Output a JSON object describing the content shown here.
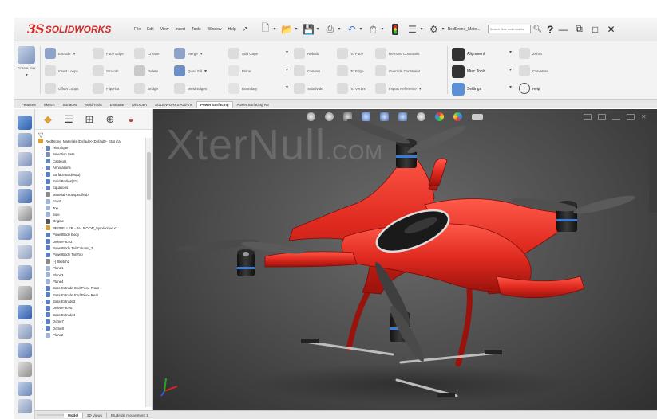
{
  "app": {
    "brand_prefix": "3S",
    "brand_name": "SOLIDWORKS",
    "menus": [
      "File",
      "Edit",
      "View",
      "Insert",
      "Tools",
      "Window",
      "Help"
    ],
    "document_name": "RedDrone_Mate...",
    "search_placeholder": "Search files and models",
    "help_symbol": "?"
  },
  "ribbon": {
    "groups": [
      {
        "label": "Create Box"
      },
      {
        "label": "Extrude"
      },
      {
        "label": "Insert Loops"
      },
      {
        "label": "Offset Loops"
      },
      {
        "label": "Face Edge"
      },
      {
        "label": "Smooth"
      },
      {
        "label": "Flip/Flat"
      },
      {
        "label": "Crease"
      },
      {
        "label": "Delete"
      },
      {
        "label": "Bridge"
      },
      {
        "label": "Merge"
      },
      {
        "label": "Quad Fill"
      },
      {
        "label": "Weld Edges"
      },
      {
        "label": "Add Cage"
      },
      {
        "label": "Mirror"
      },
      {
        "label": "Boundary"
      },
      {
        "label": "Rebuild"
      },
      {
        "label": "Convert"
      },
      {
        "label": "Subdivide"
      },
      {
        "label": "To Face"
      },
      {
        "label": "To Edge"
      },
      {
        "label": "To Vertex"
      },
      {
        "label": "Remove Constraint"
      },
      {
        "label": "Override Constraint"
      },
      {
        "label": "Import Reference"
      },
      {
        "label": "Alignment"
      },
      {
        "label": "Misc Tools"
      },
      {
        "label": "Settings"
      },
      {
        "label": "Zebra"
      },
      {
        "label": "Curvature"
      },
      {
        "label": "Help"
      }
    ]
  },
  "tabs": [
    "Features",
    "Sketch",
    "Surfaces",
    "Mold Tools",
    "Evaluate",
    "DimXpert",
    "SOLIDWORKS Add-Ins",
    "Power Surfacing",
    "Power Surfacing RE"
  ],
  "active_tab": "Power Surfacing",
  "tree": {
    "root": "RedDrone_Materials (Default<<Default>_Etat d'a",
    "items": [
      {
        "label": "Historique",
        "expand": true,
        "color": "#6a86b8"
      },
      {
        "label": "Selection Sets",
        "expand": true,
        "color": "#7b8fb3"
      },
      {
        "label": "Capteurs",
        "expand": false,
        "color": "#6a86b8"
      },
      {
        "label": "Annotations",
        "expand": true,
        "color": "#6a86b8"
      },
      {
        "label": "Surface Bodies(3)",
        "expand": true,
        "color": "#5b7fc4"
      },
      {
        "label": "Solid Bodies(21)",
        "expand": true,
        "color": "#5b7fc4"
      },
      {
        "label": "Equations",
        "expand": true,
        "color": "#6a86b8"
      },
      {
        "label": "Material <not specified>",
        "expand": false,
        "color": "#8a8a8a"
      },
      {
        "label": "Front",
        "expand": false,
        "color": "#9fb4d6"
      },
      {
        "label": "Top",
        "expand": false,
        "color": "#9fb4d6"
      },
      {
        "label": "Side",
        "expand": false,
        "color": "#9fb4d6"
      },
      {
        "label": "Origine",
        "expand": false,
        "color": "#555555"
      },
      {
        "label": "PROPELLER - 8x4.5 CCW_Symétrique <1",
        "expand": true,
        "color": "#d8a03a"
      },
      {
        "label": "PowerBody Body",
        "expand": false,
        "color": "#5b7fc4"
      },
      {
        "label": "DeleteFace3",
        "expand": false,
        "color": "#5b7fc4"
      },
      {
        "label": "PowerBody Tail Column_2",
        "expand": false,
        "color": "#5b7fc4"
      },
      {
        "label": "PowerBody Tail Top",
        "expand": false,
        "color": "#5b7fc4"
      },
      {
        "label": "(-) Sketch2",
        "expand": false,
        "color": "#888888"
      },
      {
        "label": "Plane1",
        "expand": false,
        "color": "#9fb4d6"
      },
      {
        "label": "Plane3",
        "expand": false,
        "color": "#9fb4d6"
      },
      {
        "label": "Plane4",
        "expand": false,
        "color": "#9fb4d6"
      },
      {
        "label": "Boss-Extrude End Piece Front",
        "expand": true,
        "color": "#5b7fc4"
      },
      {
        "label": "Boss-Extrude End Piece Rear",
        "expand": true,
        "color": "#5b7fc4"
      },
      {
        "label": "Boss-Extrude3",
        "expand": true,
        "color": "#5b7fc4"
      },
      {
        "label": "DeleteFace5",
        "expand": false,
        "color": "#5b7fc4"
      },
      {
        "label": "Boss-Extrude4",
        "expand": true,
        "color": "#5b7fc4"
      },
      {
        "label": "Dome7",
        "expand": true,
        "color": "#5b7fc4"
      },
      {
        "label": "Dome8",
        "expand": true,
        "color": "#5b7fc4"
      },
      {
        "label": "Plane2",
        "expand": false,
        "color": "#9fb4d6"
      }
    ]
  },
  "bottom_tabs": [
    "Model",
    "3D Views",
    "Etude de mouvement 1"
  ],
  "active_bottom_tab": "Model",
  "watermark": {
    "main": "XterNull",
    "suffix": ".COM"
  },
  "colors": {
    "brand_red": "#d32a2a",
    "drone_red": "#e02a1f",
    "viewport_bg": "#4b4b4b"
  }
}
